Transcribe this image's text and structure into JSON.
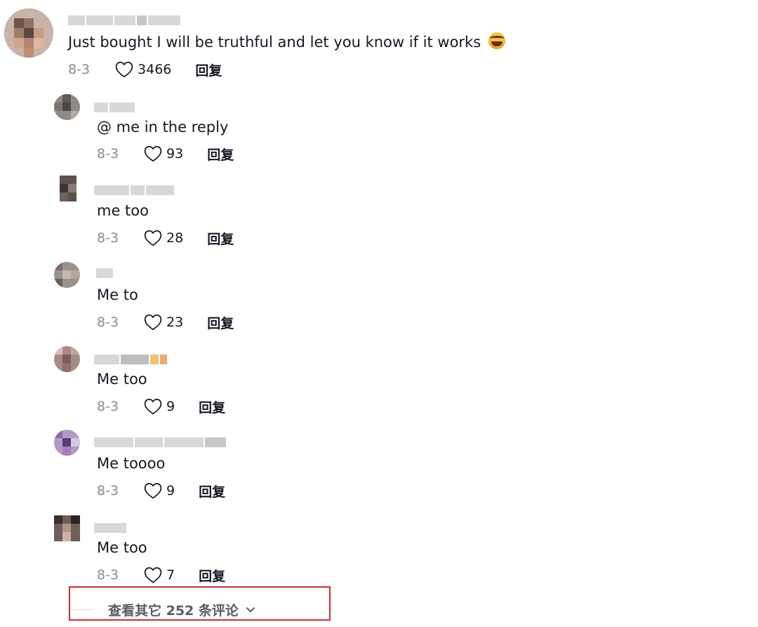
{
  "top_comment": {
    "text": "Just bought I will be truthful and let you know if it works",
    "emoji": "laughing-with-tears",
    "date": "8-3",
    "likes": "3466",
    "reply_label": "回复"
  },
  "replies": [
    {
      "text": "@ me in the reply",
      "date": "8-3",
      "likes": "93",
      "reply_label": "回复"
    },
    {
      "text": "me too",
      "date": "8-3",
      "likes": "28",
      "reply_label": "回复"
    },
    {
      "text": "Me to",
      "date": "8-3",
      "likes": "23",
      "reply_label": "回复"
    },
    {
      "text": "Me too",
      "date": "8-3",
      "likes": "9",
      "reply_label": "回复"
    },
    {
      "text": "Me toooo",
      "date": "8-3",
      "likes": "9",
      "reply_label": "回复"
    },
    {
      "text": "Me too",
      "date": "8-3",
      "likes": "7",
      "reply_label": "回复"
    }
  ],
  "view_more": {
    "label": "查看其它 252 条评论"
  },
  "colors": {
    "text": "#161823",
    "secondary": "#8a8b91",
    "highlight_border": "#e0262f"
  },
  "icons": {
    "like": "heart-outline-icon",
    "expand": "chevron-down-icon"
  }
}
